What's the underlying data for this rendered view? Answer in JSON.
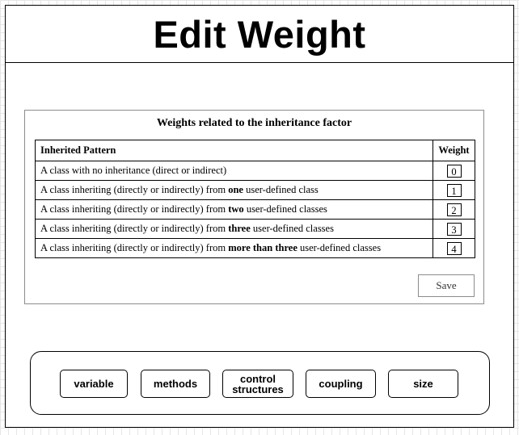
{
  "header": {
    "title": "Edit Weight"
  },
  "panel": {
    "title": "Weights related to the inheritance factor",
    "columns": {
      "pattern": "Inherited Pattern",
      "weight": "Weight"
    },
    "rows": [
      {
        "before": "A class with no inheritance (direct or indirect)",
        "bold": "",
        "after": "",
        "weight": "0"
      },
      {
        "before": "A class inheriting (directly or indirectly) from ",
        "bold": "one",
        "after": " user-defined class",
        "weight": "1"
      },
      {
        "before": "A class inheriting (directly or indirectly) from ",
        "bold": "two",
        "after": " user-defined classes",
        "weight": "2"
      },
      {
        "before": "A class inheriting (directly or indirectly) from ",
        "bold": "three",
        "after": " user-defined classes",
        "weight": "3"
      },
      {
        "before": "A class inheriting  (directly or indirectly) from ",
        "bold": "more than three",
        "after": " user-defined classes",
        "weight": "4"
      }
    ],
    "save_label": "Save"
  },
  "nav": {
    "buttons": [
      {
        "line1": "variable",
        "line2": ""
      },
      {
        "line1": "methods",
        "line2": ""
      },
      {
        "line1": "control",
        "line2": "structures"
      },
      {
        "line1": "coupling",
        "line2": ""
      },
      {
        "line1": "size",
        "line2": ""
      }
    ]
  }
}
